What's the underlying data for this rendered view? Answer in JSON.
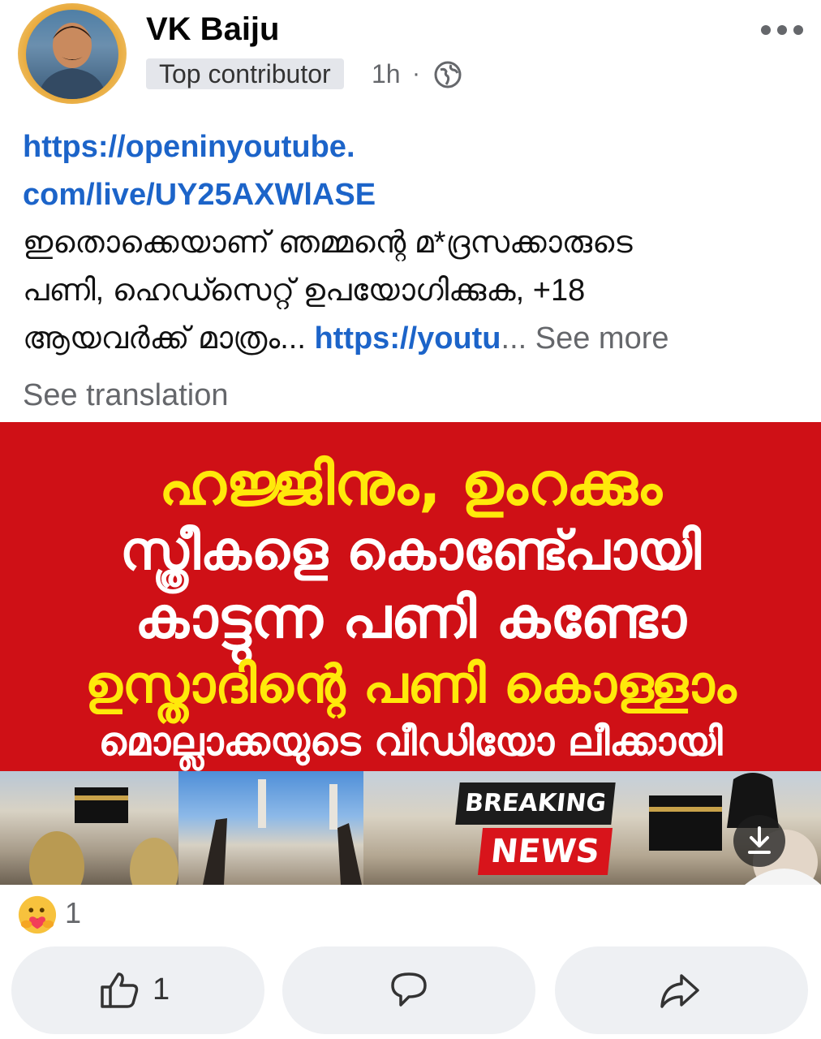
{
  "author": {
    "name": "VK Baiju",
    "badge": "Top contributor",
    "time": "1h",
    "separator": "·",
    "audience_icon": "globe-icon"
  },
  "post": {
    "link_part1": "https://openinyoutube.",
    "link_part2": "com/live/UY25AXWlASE",
    "text_line1": "ഇതൊക്കെയാണ് ഞമ്മന്റെ മ*ദ്രസക്കാരുടെ",
    "text_line2": "പണി, ഹെഡ്സെറ്റ് ഉപയോഗിക്കുക, +18",
    "text_line3": "ആയവർക്ക് മാത്രം... ",
    "link_tail": "https://youtu",
    "ellipsis": "... ",
    "see_more": "See more",
    "see_translation": "See translation"
  },
  "thumbnail": {
    "line1": "ഹജ്ജിനും, ഉംറക്കും",
    "line2": "സ്ത്രീകളെ കൊണ്ട്പോയി",
    "line3": "കാട്ടുന്ന പണി കണ്ടോ",
    "line4": "ഉസ്താദിന്റെ പണി കൊള്ളാം",
    "line5": "മൊല്ലാക്കയുടെ വീഡിയോ ലീക്കായി",
    "breaking": "BREAKING",
    "news": "NEWS",
    "colors": {
      "background": "#cf1016",
      "yellow_text": "#ffe90a",
      "white_text": "#ffffff"
    }
  },
  "reactions": {
    "icon": "care-reaction-icon",
    "count": "1"
  },
  "actions": {
    "like_icon": "thumbs-up-icon",
    "like_count": "1",
    "comment_icon": "comment-icon",
    "share_icon": "share-icon"
  },
  "colors": {
    "link": "#1c64c9",
    "muted": "#65676b",
    "button_bg": "#eef0f3"
  }
}
